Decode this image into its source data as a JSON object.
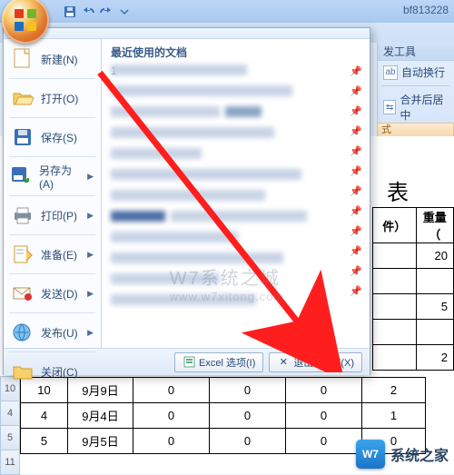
{
  "titlebar": {
    "filename": "bf813228"
  },
  "qat": {
    "save": "floppy-icon",
    "undo": "undo-icon",
    "redo": "redo-icon"
  },
  "ribbon": {
    "dev_tab": "发工具",
    "wrap_text": "自动换行",
    "merge_center": "合并后居中",
    "fmt_label": "式"
  },
  "office_menu": {
    "recent_header": "最近使用的文档",
    "items": {
      "new": {
        "label": "新建(N)"
      },
      "open": {
        "label": "打开(O)"
      },
      "save": {
        "label": "保存(S)"
      },
      "saveas": {
        "label": "另存为(A)"
      },
      "print": {
        "label": "打印(P)"
      },
      "prep": {
        "label": "准备(E)"
      },
      "send": {
        "label": "发送(D)"
      },
      "publish": {
        "label": "发布(U)"
      },
      "close": {
        "label": "关闭(C)"
      }
    },
    "recent_first_num": "1",
    "options_btn": "Excel 选项(I)",
    "exit_btn": "退出 Excel(X)"
  },
  "sheet": {
    "title_fragment": "表",
    "headers": {
      "count_unit": "件）",
      "weight": "重量（"
    },
    "partial_right": {
      "r1": "20",
      "r2": "5",
      "r3": "2"
    },
    "rowheaders": [
      "10",
      "4",
      "5",
      "11"
    ],
    "rows": [
      {
        "a": "10",
        "b": "9月9日",
        "c": "0",
        "d": "0",
        "e": "0",
        "f": "2"
      },
      {
        "a": "4",
        "b": "9月4日",
        "c": "0",
        "d": "0",
        "e": "0",
        "f": "1"
      },
      {
        "a": "5",
        "b": "9月5日",
        "c": "0",
        "d": "0",
        "e": "0",
        "f": "0"
      }
    ]
  },
  "watermark": {
    "line1": "W7系统之城",
    "line2": "www.w7xitong.com"
  },
  "footer": {
    "badge": "W7",
    "text": "系统之家"
  },
  "colors": {
    "accent": "#2b4b77",
    "arrow": "#ff1e1e"
  }
}
